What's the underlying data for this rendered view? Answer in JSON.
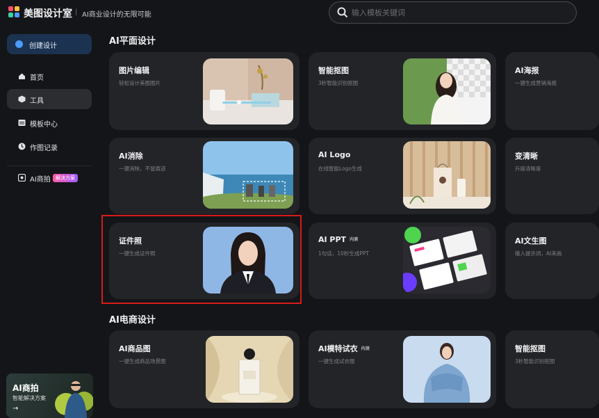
{
  "header": {
    "app_name": "美图设计室",
    "separator": "|",
    "slogan": "AI商业设计的无限可能",
    "search_placeholder": "输入模板关键词"
  },
  "sidebar": {
    "create_label": "创建设计",
    "items": [
      {
        "label": "首页",
        "icon": "home-icon",
        "active": false
      },
      {
        "label": "工具",
        "icon": "tools-icon",
        "active": true
      },
      {
        "label": "模板中心",
        "icon": "template-icon",
        "active": false
      },
      {
        "label": "作图记录",
        "icon": "history-icon",
        "active": false
      },
      {
        "label": "AI商拍",
        "icon": "ai-shoot-icon",
        "active": false,
        "badge": "解决方案"
      }
    ],
    "promo": {
      "title": "AI商拍",
      "subtitle": "智能解决方案",
      "arrow": "→"
    }
  },
  "sections": [
    {
      "title": "AI平面设计",
      "cards": [
        {
          "title": "图片编辑",
          "desc": "轻松设计美图图片"
        },
        {
          "title": "智能抠图",
          "desc": "3秒智能识别抠图"
        },
        {
          "title": "AI海报",
          "desc": "一键生成营销海报"
        },
        {
          "title": "AI消除",
          "desc": "一键消除，不留痕迹"
        },
        {
          "title": "AI Logo",
          "desc": "在线智能Logo生成"
        },
        {
          "title": "变清晰",
          "desc": "升级清晰度"
        },
        {
          "title": "证件照",
          "desc": "一键生成证件照"
        },
        {
          "title": "AI PPT",
          "tag": "内测",
          "desc": "1句话，10秒生成PPT"
        },
        {
          "title": "AI文生图",
          "desc": "输入提示词，AI来画"
        }
      ]
    },
    {
      "title": "AI电商设计",
      "cards": [
        {
          "title": "AI商品图",
          "desc": "一键生成商品场景图"
        },
        {
          "title": "AI模特试衣",
          "tag": "内测",
          "desc": "一键生成试衣图"
        },
        {
          "title": "智能抠图",
          "desc": "3秒智能识别抠图"
        }
      ]
    }
  ],
  "colors": {
    "accent": "#4c9bff",
    "highlight": "#d81b1b",
    "card_bg": "#232428",
    "page_bg": "#141518"
  }
}
